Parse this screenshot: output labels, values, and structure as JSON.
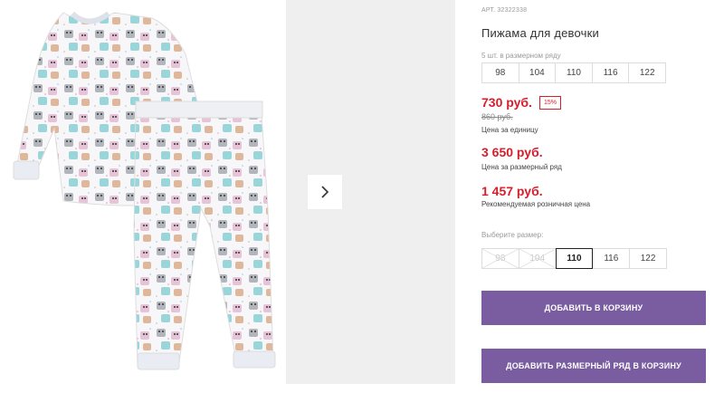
{
  "product": {
    "sku": "АРТ. 32322338",
    "title": "Пижама для девочки",
    "pack_note": "5 шт. в размерном ряду",
    "pack_sizes": [
      "98",
      "104",
      "110",
      "116",
      "122"
    ]
  },
  "pricing": {
    "unit_price": "730 руб.",
    "discount": "15%",
    "old_price": "860 руб.",
    "unit_caption": "Цена за единицу",
    "pack_price": "3 650 руб.",
    "pack_caption": "Цена за размерный ряд",
    "retail_price": "1 457 руб.",
    "retail_caption": "Рекомендуемая розничная цена"
  },
  "size_picker": {
    "label": "Выберите размер:",
    "options": [
      {
        "label": "98",
        "state": "disabled"
      },
      {
        "label": "104",
        "state": "disabled"
      },
      {
        "label": "110",
        "state": "selected"
      },
      {
        "label": "116",
        "state": "available"
      },
      {
        "label": "122",
        "state": "available"
      }
    ]
  },
  "actions": {
    "add_to_cart": "ДОБАВИТЬ В КОРЗИНУ",
    "add_pack_to_cart": "ДОБАВИТЬ РАЗМЕРНЫЙ РЯД В КОРЗИНУ"
  },
  "colors": {
    "accent_button": "#7a5da1",
    "price_red": "#d71e2b"
  },
  "icons": {
    "gallery_next": "chevron-right-icon"
  }
}
